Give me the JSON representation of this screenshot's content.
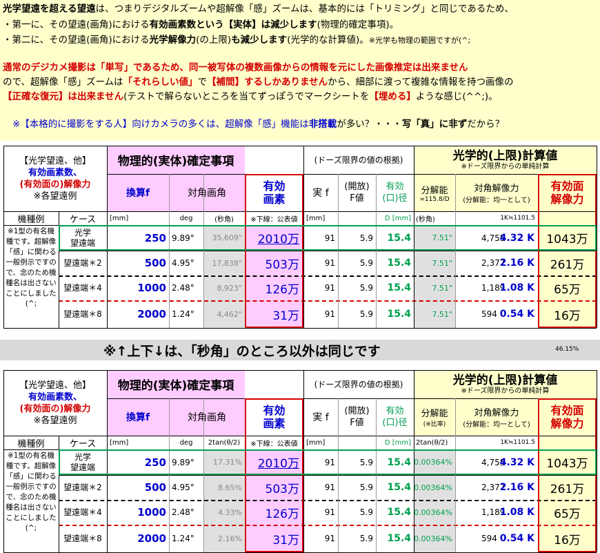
{
  "notes": {
    "l1_a": "光学望遠を超える望遠",
    "l1_b": "は、つまりデジタルズームや超解像「感」ズームは、基本的には「トリミング」と同じであるため、",
    "l2_a": "・第一に、その望遠(画角)における",
    "l2_b": "有効画素数という【実体】は減少します",
    "l2_c": "(物理的確定事項)。",
    "l3_a": "・第二に、その望遠(画角)における",
    "l3_b": "光学解像力",
    "l3_c": "(の上限)",
    "l3_d": "も減少します",
    "l3_e": "(光学的な計算値)。",
    "l3_f": "※光学も物理の範囲ですが(^;",
    "l4": "通常のデジカメ撮影は「単写」であるため、同一被写体の複数画像からの情報を元にした画像推定は出来ません",
    "l5_a": "ので、超解像「感」ズームは",
    "l5_b": "「それらしい値」",
    "l5_c": "で",
    "l5_d": "【補間】",
    "l5_e": "するしかありません",
    "l5_f": "から、細部に渡って複雑な情報を持つ画像の",
    "l6_a": "【正確な復元】は出来ません",
    "l6_b": "(テストで解らないところを当てずっぽうでマークシートを",
    "l6_c": "【埋める】",
    "l6_d": "ような感じ(^^;)。",
    "l7_a": "※【本格的に撮影をする人】向けカメラの多くは、超解像「感」機能は",
    "l7_b": "非搭載",
    "l7_c": "が多い？・・・",
    "l7_d": "写「真」に非ず",
    "l7_e": "だから？"
  },
  "tables": [
    {
      "corner": {
        "l1": "【光学望遠、他】",
        "l2": "有効画素数、",
        "l3": "(有効面の)解像力",
        "l4": "※各望遠例"
      },
      "phys_title": "物理的(実体)確定事項",
      "doors_title": "(ドーズ限界の値の根拠)",
      "opt_title": "光学的(上限)計算値",
      "opt_sub": "※ドーズ限界からの単純計算",
      "h_f": "換算f",
      "h_angle": "対角画角",
      "h_pix": "有効\n画素",
      "h_realf": "実 f",
      "h_fval": "(開放)\nF値",
      "h_ap": "有効\n(口)径",
      "h_res": "分解能",
      "h_res_sub": "=115.8/D",
      "h_diag": "対角解像力",
      "h_diag_sub": "(分解能：均一として)",
      "h_eff": "有効面\n解像力",
      "u_model": "機種例",
      "u_case": "ケース",
      "u_mm": "[mm]",
      "u_deg": "deg",
      "u_third": "(秒角)",
      "u_pix": "※下線：公表値",
      "u_mm2": "[mm]",
      "u_d": "D [mm]",
      "u_sec": "(秒角)",
      "u_k": "1K≒1101.5",
      "side_note": "※1型の有名機種です。超解像「感」に関わる一般例示ですので、念のため機種名は出さないことにしました(^;",
      "rows": [
        {
          "case": "光学\n望遠端",
          "f": "250",
          "deg": "9.89°",
          "third": "35,609\"",
          "pix": "2010万",
          "realf": "91",
          "fval": "5.9",
          "ap": "15.4",
          "res": "7.51\"",
          "diag": "4,755",
          "k": "4.32 K",
          "eff": "1043万"
        },
        {
          "case": "望遠端＊2",
          "f": "500",
          "deg": "4.95°",
          "third": "17,838\"",
          "pix": "503万",
          "realf": "91",
          "fval": "5.9",
          "ap": "15.4",
          "res": "7.51\"",
          "diag": "2,377",
          "k": "2.16 K",
          "eff": "261万"
        },
        {
          "case": "望遠端＊4",
          "f": "1000",
          "deg": "2.48°",
          "third": "8,923\"",
          "pix": "126万",
          "realf": "91",
          "fval": "5.9",
          "ap": "15.4",
          "res": "7.51\"",
          "diag": "1,189",
          "k": "1.08 K",
          "eff": "65万"
        },
        {
          "case": "望遠端＊8",
          "f": "2000",
          "deg": "1.24°",
          "third": "4,462\"",
          "pix": "31万",
          "realf": "91",
          "fval": "5.9",
          "ap": "15.4",
          "res": "7.51\"",
          "diag": "594",
          "k": "0.54 K",
          "eff": "16万"
        }
      ]
    },
    {
      "corner": {
        "l1": "【光学望遠、他】",
        "l2": "有効画素数、",
        "l3": "(有効面の)解像力",
        "l4": "※各望遠例"
      },
      "phys_title": "物理的(実体)確定事項",
      "doors_title": "(ドーズ限界の値の根拠)",
      "opt_title": "光学的(上限)計算値",
      "opt_sub": "※ドーズ限界からの単純計算",
      "h_f": "換算f",
      "h_angle": "対角画角",
      "h_pix": "有効\n画素",
      "h_realf": "実 f",
      "h_fval": "(開放)\nF値",
      "h_ap": "有効\n(口)径",
      "h_res": "分解能",
      "h_res_sub": "(※比率)",
      "h_diag": "対角解像力",
      "h_diag_sub": "(分解能：均一として)",
      "h_eff": "有効面\n解像力",
      "u_model": "機種例",
      "u_case": "ケース",
      "u_mm": "[mm]",
      "u_deg": "deg",
      "u_third": "2tan(θ/2)",
      "u_pix": "※下線：公表値",
      "u_mm2": "[mm]",
      "u_d": "D [mm]",
      "u_sec": "2tan(θ/2)",
      "u_k": "1K≒1101.5",
      "side_note": "※1型の有名機種です。超解像「感」に関わる一般例示ですので、念のため機種名は出さないことにしました(^;",
      "rows": [
        {
          "case": "光学\n望遠端",
          "f": "250",
          "deg": "9.89°",
          "third": "17.31%",
          "pix": "2010万",
          "realf": "91",
          "fval": "5.9",
          "ap": "15.4",
          "res": "0.00364%",
          "diag": "4,755",
          "k": "4.32 K",
          "eff": "1043万"
        },
        {
          "case": "望遠端＊2",
          "f": "500",
          "deg": "4.95°",
          "third": "8.65%",
          "pix": "503万",
          "realf": "91",
          "fval": "5.9",
          "ap": "15.4",
          "res": "0.00364%",
          "diag": "2,377",
          "k": "2.16 K",
          "eff": "261万"
        },
        {
          "case": "望遠端＊4",
          "f": "1000",
          "deg": "2.48°",
          "third": "4.33%",
          "pix": "126万",
          "realf": "91",
          "fval": "5.9",
          "ap": "15.4",
          "res": "0.00364%",
          "diag": "1,189",
          "k": "1.08 K",
          "eff": "65万"
        },
        {
          "case": "望遠端＊8",
          "f": "2000",
          "deg": "1.24°",
          "third": "2.16%",
          "pix": "31万",
          "realf": "91",
          "fval": "5.9",
          "ap": "15.4",
          "res": "0.00364%",
          "diag": "594",
          "k": "0.54 K",
          "eff": "16万"
        }
      ]
    }
  ],
  "banner": {
    "text": "※↑上下↓は、「秒角」のところ以外は同じです",
    "pct": "46.15%"
  },
  "colors": {
    "notes_bg": "#ffffcc",
    "pink": "#ffccff",
    "red": "#d40000",
    "green": "#00a050",
    "blue": "#0000cc",
    "purple": "#800080"
  }
}
